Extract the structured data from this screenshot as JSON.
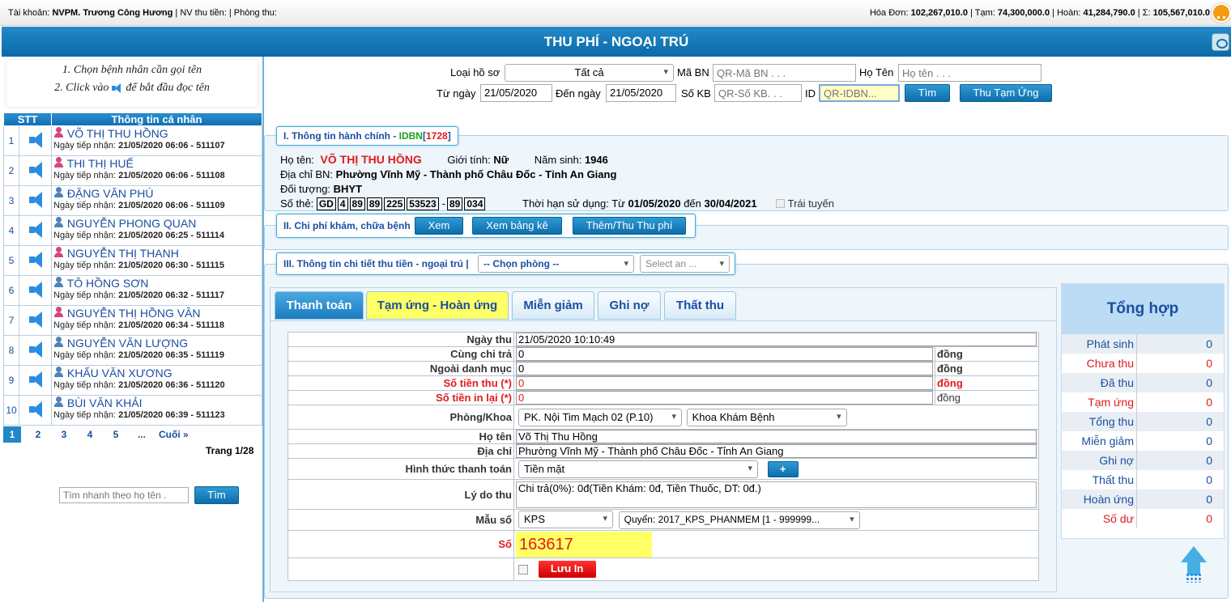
{
  "topbar": {
    "account_label": "Tài khoản:",
    "account_name": "NVPM. Trương Công Hương",
    "collector_label": "| NV thu tiền: | Phòng thu:",
    "invoice_label": "Hóa Đơn:",
    "invoice_value": "102,267,010.0",
    "advance_label": "| Tạm:",
    "advance_value": "74,300,000.0",
    "refund_label": "| Hoàn:",
    "refund_value": "41,284,790.0",
    "total_label": "| Σ:",
    "total_value": "105,567,010.0"
  },
  "title": "THU PHÍ - NGOẠI TRÚ",
  "instructions": {
    "line1": "1. Chọn bệnh nhân cần gọi tên",
    "line2_a": "2. Click vào",
    "line2_b": "để bắt đầu đọc tên"
  },
  "patient_table": {
    "col_stt": "STT",
    "col_info": "Thông tin cá nhân",
    "received_label": "Ngày tiếp nhận:",
    "rows": [
      {
        "stt": "1",
        "name": "VÕ THỊ THU HỒNG",
        "gender": "f",
        "time": "21/05/2020 06:06 - 511107"
      },
      {
        "stt": "2",
        "name": "THI THỊ HUẾ",
        "gender": "f",
        "time": "21/05/2020 06:06 - 511108"
      },
      {
        "stt": "3",
        "name": "ĐẶNG VĂN PHÚ",
        "gender": "m",
        "time": "21/05/2020 06:06 - 511109"
      },
      {
        "stt": "4",
        "name": "NGUYỄN PHONG QUAN",
        "gender": "m",
        "time": "21/05/2020 06:25 - 511114"
      },
      {
        "stt": "5",
        "name": "NGUYỄN THỊ THANH",
        "gender": "f",
        "time": "21/05/2020 06:30 - 511115"
      },
      {
        "stt": "6",
        "name": "TÔ HỒNG SƠN",
        "gender": "m",
        "time": "21/05/2020 06:32 - 511117"
      },
      {
        "stt": "7",
        "name": "NGUYỄN THỊ HỒNG VÂN",
        "gender": "f",
        "time": "21/05/2020 06:34 - 511118"
      },
      {
        "stt": "8",
        "name": "NGUYỄN VĂN LƯỢNG",
        "gender": "m",
        "time": "21/05/2020 06:35 - 511119"
      },
      {
        "stt": "9",
        "name": "KHẤU VĂN XƯƠNG",
        "gender": "m",
        "time": "21/05/2020 06:36 - 511120"
      },
      {
        "stt": "10",
        "name": "BÙI VĂN KHẢI",
        "gender": "m",
        "time": "21/05/2020 06:39 - 511123"
      }
    ]
  },
  "pager": {
    "pages": [
      "1",
      "2",
      "3",
      "4",
      "5",
      "..."
    ],
    "last": "Cuối »",
    "info": "Trang 1/28"
  },
  "quick_search": {
    "placeholder": "Tìm nhanh theo họ tên .",
    "button": "Tìm"
  },
  "filter": {
    "record_type_label": "Loại hồ sơ",
    "record_type_value": "Tất cả",
    "mabn_label": "Mã BN",
    "mabn_placeholder": "QR-Mã BN . . .",
    "name_label": "Họ Tên",
    "name_placeholder": "Họ tên . . .",
    "from_label": "Từ ngày",
    "from_value": "21/05/2020",
    "to_label": "Đến ngày",
    "to_value": "21/05/2020",
    "sokb_label": "Số KB",
    "sokb_placeholder": "QR-Số KB. . .",
    "id_label": "ID",
    "id_placeholder": "QR-IDBN...",
    "search_button": "Tìm",
    "advance_button": "Thu Tạm Ứng"
  },
  "section1": {
    "legend_a": "I. Thông tin hành chính - ",
    "legend_b": "IDBN",
    "legend_c": "[",
    "legend_d": "1728",
    "legend_e": "]",
    "name_label": "Họ tên:",
    "name_value": "VÕ THỊ THU HỒNG",
    "gender_label": "Giới tính:",
    "gender_value": "Nữ",
    "birth_label": "Năm sinh:",
    "birth_value": "1946",
    "address_label": "Địa chỉ BN:",
    "address_value": "Phường Vĩnh Mỹ - Thành phố Châu Đốc - Tỉnh An Giang",
    "object_label": "Đối tượng:",
    "object_value": "BHYT",
    "card_label": "Số thẻ:",
    "card_parts": [
      "GD",
      "4",
      "89",
      "89",
      "225",
      "53523",
      "-",
      "89",
      "034"
    ],
    "validity_label": "Thời hạn sử dụng: Từ",
    "validity_from": "01/05/2020",
    "validity_mid": "đến",
    "validity_to": "30/04/2021",
    "offline_label": "Trái tuyến"
  },
  "section2": {
    "legend": "II. Chi phí khám, chữa bệnh",
    "btn_view": "Xem",
    "btn_list": "Xem bảng kê",
    "btn_add": "Thêm/Thu Thu phí"
  },
  "section3": {
    "legend": "III. Thông tin chi tiết thu tiền - ngoại trú |",
    "room_select": "-- Chọn phòng --",
    "an_select": "Select an ..."
  },
  "tabs": [
    "Thanh toán",
    "Tạm ứng - Hoàn ứng",
    "Miễn giảm",
    "Ghi nợ",
    "Thất thu"
  ],
  "form": {
    "date_label": "Ngày thu",
    "date_value": "21/05/2020 10:10:49",
    "copay_label": "Cùng chi trả",
    "copay_value": "0",
    "outside_label": "Ngoài danh mục",
    "outside_value": "0",
    "amount_label": "Số tiền thu (*)",
    "amount_value": "0",
    "remain_label": "Số tiền in lại (*)",
    "remain_value": "0",
    "unit": "đồng",
    "room_label": "Phòng/Khoa",
    "room_value": "PK. Nội Tim Mạch 02 (P.10)",
    "dept_value": "Khoa Khám Bệnh",
    "name_label": "Họ tên",
    "name_value": "Võ Thị Thu Hồng",
    "addr_label": "Địa chỉ",
    "addr_value": "Phường Vĩnh Mỹ - Thành phố Châu Đốc - Tỉnh An Giang",
    "method_label": "Hình thức thanh toán",
    "method_value": "Tiền mặt",
    "plus": "+",
    "reason_label": "Lý do thu",
    "reason_value": "Chi trả(0%): 0đ(Tiền Khám: 0đ, Tiền Thuốc, DT: 0đ.)",
    "template_label": "Mẫu số",
    "template_value": "KPS",
    "book_value": "Quyển: 2017_KPS_PHANMEM [1 - 999999...",
    "number_label": "Số",
    "number_value": "163617",
    "save_button": "Lưu In"
  },
  "summary": {
    "title": "Tổng hợp",
    "rows": [
      {
        "label": "Phát sinh",
        "value": "0",
        "color": "#1a4fa0"
      },
      {
        "label": "Chưa thu",
        "value": "0",
        "color": "#e01b1b"
      },
      {
        "label": "Đã thu",
        "value": "0",
        "color": "#1a4fa0"
      },
      {
        "label": "Tạm ứng",
        "value": "0",
        "color": "#e01b1b"
      },
      {
        "label": "Tổng thu",
        "value": "0",
        "color": "#1a4fa0"
      },
      {
        "label": "Miễn giảm",
        "value": "0",
        "color": "#1a4fa0"
      },
      {
        "label": "Ghi nợ",
        "value": "0",
        "color": "#1a4fa0"
      },
      {
        "label": "Thất thu",
        "value": "0",
        "color": "#1a4fa0"
      },
      {
        "label": "Hoàn ứng",
        "value": "0",
        "color": "#1a4fa0"
      },
      {
        "label": "Số dư",
        "value": "0",
        "color": "#e01b1b"
      }
    ]
  }
}
